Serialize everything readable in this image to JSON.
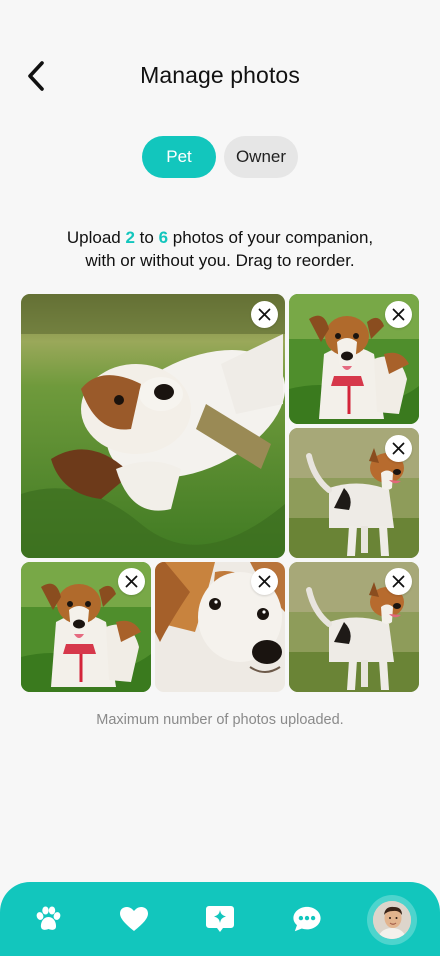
{
  "header": {
    "title": "Manage photos"
  },
  "toggle": {
    "options": [
      {
        "label": "Pet"
      },
      {
        "label": "Owner"
      }
    ]
  },
  "instructions": {
    "part1": "Upload ",
    "min": "2",
    "part2": " to ",
    "max": "6",
    "part3": " photos of your companion,",
    "line2": "with or without you. Drag to reorder."
  },
  "photos": [
    {
      "subject": "dog lying on back in grass"
    },
    {
      "subject": "dog sitting in grass with red harness"
    },
    {
      "subject": "dog standing on grass"
    },
    {
      "subject": "dog sitting in grass with red harness"
    },
    {
      "subject": "dog face close-up"
    },
    {
      "subject": "dog standing on grass"
    }
  ],
  "status": {
    "text": "Maximum number of photos uploaded."
  },
  "nav": {
    "items": [
      {
        "icon": "paw-icon"
      },
      {
        "icon": "heart-icon"
      },
      {
        "icon": "sparkle-chat-icon"
      },
      {
        "icon": "chat-bubble-icon"
      },
      {
        "icon": "profile-avatar"
      }
    ]
  },
  "colors": {
    "accent": "#12c6bd",
    "background": "#f7f7f7"
  }
}
